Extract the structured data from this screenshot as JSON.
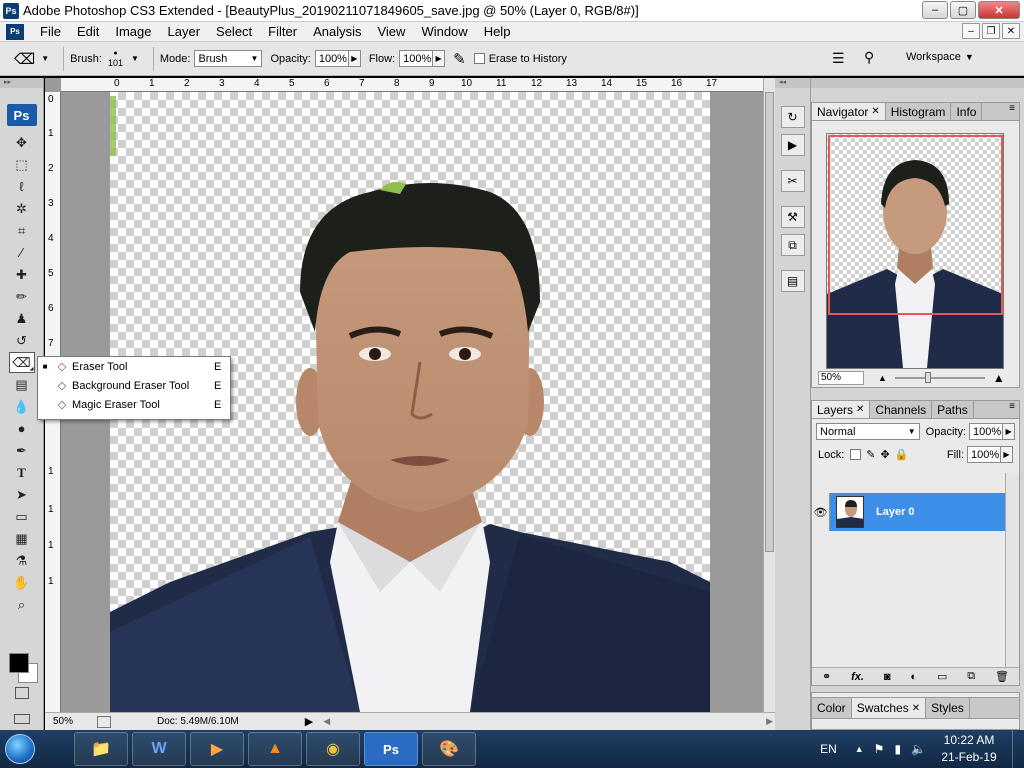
{
  "window": {
    "title": "Adobe Photoshop CS3 Extended - [BeautyPlus_20190211071849605_save.jpg @ 50% (Layer 0, RGB/8#)]",
    "app_badge": "Ps",
    "controls": {
      "minimize": "–",
      "maximize": "▢",
      "close": "✕"
    }
  },
  "menubar": {
    "items": [
      "File",
      "Edit",
      "Image",
      "Layer",
      "Select",
      "Filter",
      "Analysis",
      "View",
      "Window",
      "Help"
    ],
    "doc_controls": {
      "minimize": "–",
      "restore": "❐",
      "close": "✕"
    }
  },
  "options": {
    "brush_label": "Brush:",
    "brush_size": "101",
    "mode_label": "Mode:",
    "mode_value": "Brush",
    "opacity_label": "Opacity:",
    "opacity_value": "100%",
    "flow_label": "Flow:",
    "flow_value": "100%",
    "erase_history_label": "Erase to History",
    "workspace_label": "Workspace"
  },
  "toolbox": {
    "ps_label": "Ps",
    "active_tool": "eraser",
    "foreground_color": "#000000",
    "background_color": "#ffffff"
  },
  "flyout": {
    "items": [
      {
        "label": "Eraser Tool",
        "key": "E",
        "selected": true
      },
      {
        "label": "Background Eraser Tool",
        "key": "E",
        "selected": false
      },
      {
        "label": "Magic Eraser Tool",
        "key": "E",
        "selected": false
      }
    ]
  },
  "rulers": {
    "horizontal": [
      "0",
      "1",
      "2",
      "3",
      "4",
      "5",
      "6",
      "7",
      "8",
      "9",
      "10",
      "11",
      "12",
      "13",
      "14",
      "15",
      "16",
      "17"
    ],
    "vertical": [
      "0",
      "1",
      "2",
      "3",
      "4",
      "5",
      "6",
      "7",
      "8",
      "9",
      "1",
      "1",
      "1",
      "1"
    ]
  },
  "status": {
    "zoom": "50%",
    "doc": "Doc: 5.49M/6.10M"
  },
  "navigator": {
    "tabs": [
      "Navigator",
      "Histogram",
      "Info"
    ],
    "zoom": "50%",
    "view_frame_color": "#e05a5a"
  },
  "layers_panel": {
    "tabs": [
      "Layers",
      "Channels",
      "Paths"
    ],
    "blend_mode": "Normal",
    "opacity_label": "Opacity:",
    "opacity_value": "100%",
    "lock_label": "Lock:",
    "fill_label": "Fill:",
    "fill_value": "100%",
    "layers": [
      {
        "name": "Layer 0",
        "visible": true,
        "selected": true
      }
    ],
    "footer_icons": [
      "link-icon",
      "fx-icon",
      "mask-icon",
      "adjustment-icon",
      "group-icon",
      "new-layer-icon",
      "trash-icon"
    ],
    "fx_label": "fx."
  },
  "swatches_panel": {
    "tabs": [
      "Color",
      "Swatches",
      "Styles"
    ]
  },
  "taskbar": {
    "tray_lang": "EN",
    "time": "10:22 AM",
    "date": "21-Feb-19",
    "apps": [
      "explorer",
      "word",
      "media-player",
      "vlc",
      "chrome",
      "photoshop",
      "paint"
    ]
  },
  "colors": {
    "accent_selection": "#3c8ee6",
    "taskbar": "#1e3f66",
    "workspace_gray": "#9a9a9a"
  }
}
